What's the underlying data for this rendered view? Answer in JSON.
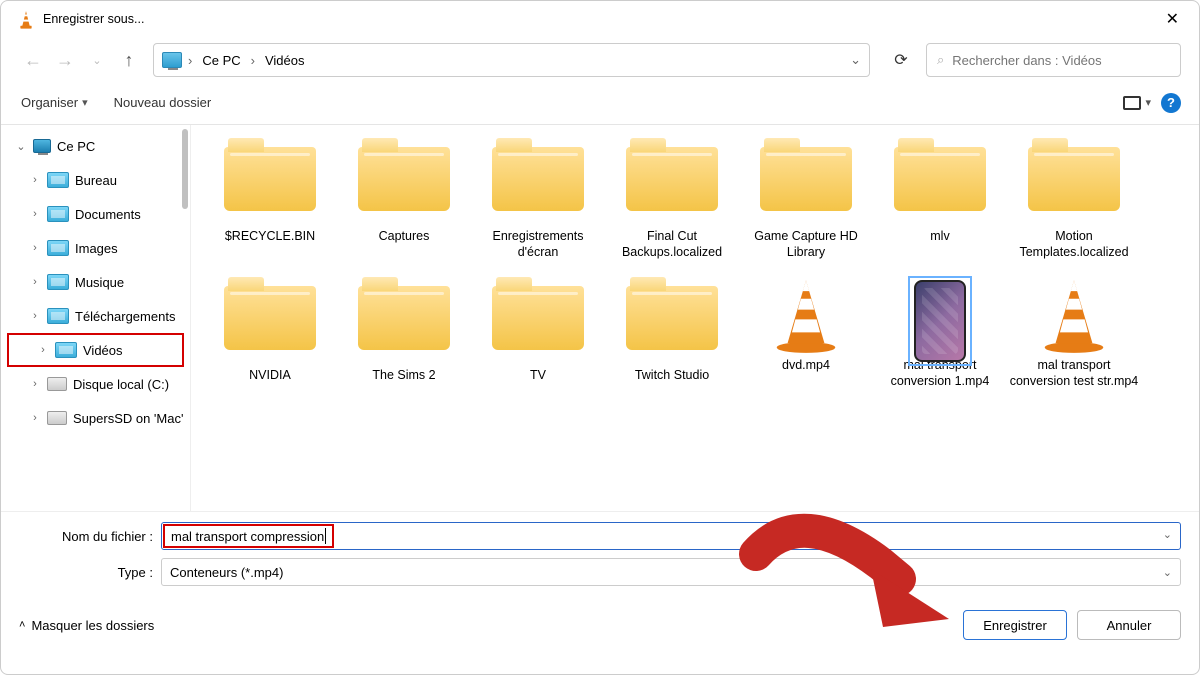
{
  "title": "Enregistrer sous...",
  "breadcrumb": {
    "root": "Ce PC",
    "folder": "Vidéos"
  },
  "nav": {
    "refresh": "↻"
  },
  "search": {
    "placeholder": "Rechercher dans : Vidéos"
  },
  "toolbar": {
    "organize": "Organiser",
    "new_folder": "Nouveau dossier"
  },
  "sidebar": {
    "root": "Ce PC",
    "items": [
      {
        "label": "Bureau"
      },
      {
        "label": "Documents"
      },
      {
        "label": "Images"
      },
      {
        "label": "Musique"
      },
      {
        "label": "Téléchargements"
      },
      {
        "label": "Vidéos"
      },
      {
        "label": "Disque local (C:)"
      },
      {
        "label": "SupersSD on 'Mac'"
      }
    ]
  },
  "items": [
    {
      "label": "$RECYCLE.BIN",
      "kind": "folder"
    },
    {
      "label": "Captures",
      "kind": "folder"
    },
    {
      "label": "Enregistrements d'écran",
      "kind": "folder"
    },
    {
      "label": "Final Cut Backups.localized",
      "kind": "folder"
    },
    {
      "label": "Game Capture HD Library",
      "kind": "folder"
    },
    {
      "label": "mlv",
      "kind": "folder"
    },
    {
      "label": "Motion Templates.localized",
      "kind": "folder"
    },
    {
      "label": "NVIDIA",
      "kind": "folder"
    },
    {
      "label": "The Sims 2",
      "kind": "folder"
    },
    {
      "label": "TV",
      "kind": "folder"
    },
    {
      "label": "Twitch Studio",
      "kind": "folder"
    },
    {
      "label": "dvd.mp4",
      "kind": "video-cone"
    },
    {
      "label": "mal transport conversion 1.mp4",
      "kind": "video-thumb"
    },
    {
      "label": "mal transport conversion test str.mp4",
      "kind": "video-cone"
    }
  ],
  "filename": {
    "label": "Nom du fichier :",
    "value": "mal transport compression"
  },
  "type": {
    "label": "Type :",
    "value": "Conteneurs (*.mp4)"
  },
  "footer": {
    "hide": "Masquer les dossiers",
    "save": "Enregistrer",
    "cancel": "Annuler"
  }
}
